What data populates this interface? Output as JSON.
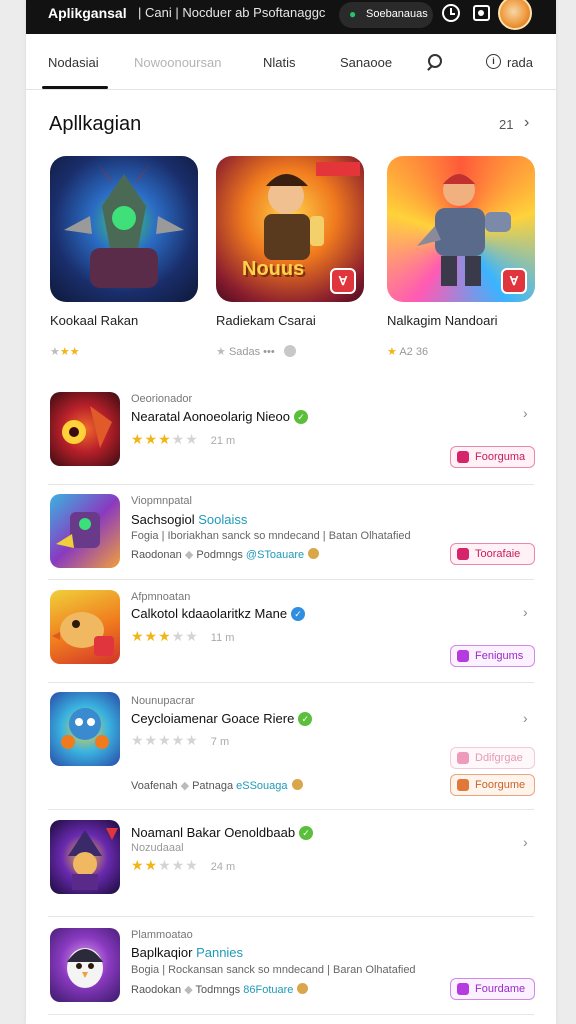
{
  "topbar": {
    "title": "Aplikgansal",
    "subtitle": "| Cani | Nocduer ab Psoftanaggc",
    "account_label": "Soebanauas"
  },
  "tabs": [
    {
      "label": "Nodasiai",
      "active": true
    },
    {
      "label": "Nowoonoursan",
      "active": false
    },
    {
      "label": "Nlatis",
      "active": false
    },
    {
      "label": "Sanaooe",
      "active": false
    }
  ],
  "tabs_extra": {
    "info_label": "rada"
  },
  "section": {
    "title": "Apllkagian",
    "count": "21"
  },
  "featured": [
    {
      "name": "Kookaal Rakan",
      "meta": "",
      "stars": 3,
      "icon": "armored-knight-icon"
    },
    {
      "name": "Radiekam Csarai",
      "meta": "Sadas  •••",
      "stars": 1,
      "icon": "adventurer-icon",
      "art_text": "Nouus",
      "corner": "ACME"
    },
    {
      "name": "Nalkagim Nandoari",
      "meta": "A2  36",
      "stars": 1,
      "icon": "robot-hero-icon"
    }
  ],
  "list": [
    {
      "kicker": "Oeorionador",
      "title": "Nearatal Aonoeolarig Nieoo",
      "tag": "",
      "verified": "green",
      "desc": "",
      "stars": 3,
      "size": "21 m",
      "foot_left": "",
      "foot_mid": "",
      "foot_tag": "",
      "pill": "Foorguma",
      "pill_style": "",
      "icon": "crimson-beast-icon"
    },
    {
      "kicker": "Viopmnpatal",
      "title": "Sachsogiol",
      "tag": "Soolaiss",
      "verified": "",
      "desc": "Fogia | Iboriakhan sanck so mndecand | Batan Olhatafied",
      "stars": 0,
      "size": "",
      "foot_left": "Raodonan",
      "foot_mid": "Podmngs",
      "foot_tag": "@SToauare",
      "pill": "Toorafaie",
      "pill_style": "",
      "icon": "mech-warrior-icon"
    },
    {
      "kicker": "Afpmnoatan",
      "title": "Calkotol kdaaolaritkz Mane",
      "tag": "",
      "verified": "blue",
      "desc": "",
      "stars": 3,
      "size": "11 m",
      "foot_left": "",
      "foot_mid": "",
      "foot_tag": "",
      "pill": "Fenigums",
      "pill_style": "purple",
      "icon": "duck-mascot-icon"
    },
    {
      "kicker": "Nounupacrar",
      "title": "Ceycloiamenar Goace Riere",
      "tag": "",
      "verified": "green",
      "desc": "",
      "stars": 0,
      "size": "7 m",
      "foot_left": "Voafenah",
      "foot_mid": "Patnaga",
      "foot_tag": "eSSouaga",
      "pill": "Foorgume",
      "pill_style": "orange",
      "pill_top": "Ddifgrgae",
      "icon": "blue-robot-icon"
    },
    {
      "kicker": "",
      "title": "Noamanl Bakar Oenoldbaab",
      "tag": "",
      "verified": "green",
      "desc": "Nozudaaal",
      "stars": 2,
      "size": "24 m",
      "foot_left": "",
      "foot_mid": "",
      "foot_tag": "",
      "pill": "",
      "pill_style": "",
      "icon": "arcane-mage-icon"
    },
    {
      "kicker": "Plammoatao",
      "title": "Baplkaqior",
      "tag": "Pannies",
      "verified": "",
      "desc": "Bogia | Rockansan sanck so mndecand | Baran Olhatafied",
      "stars": 0,
      "size": "",
      "foot_left": "Raodokan",
      "foot_mid": "Todmngs",
      "foot_tag": "86Fotuare",
      "pill": "Fourdame",
      "pill_style": "purple",
      "icon": "penguin-helmet-icon"
    }
  ],
  "colors": {
    "accent": "#1f9ab8",
    "star": "#f1b516",
    "topbar": "#121212",
    "pill": "#c61e5c"
  }
}
